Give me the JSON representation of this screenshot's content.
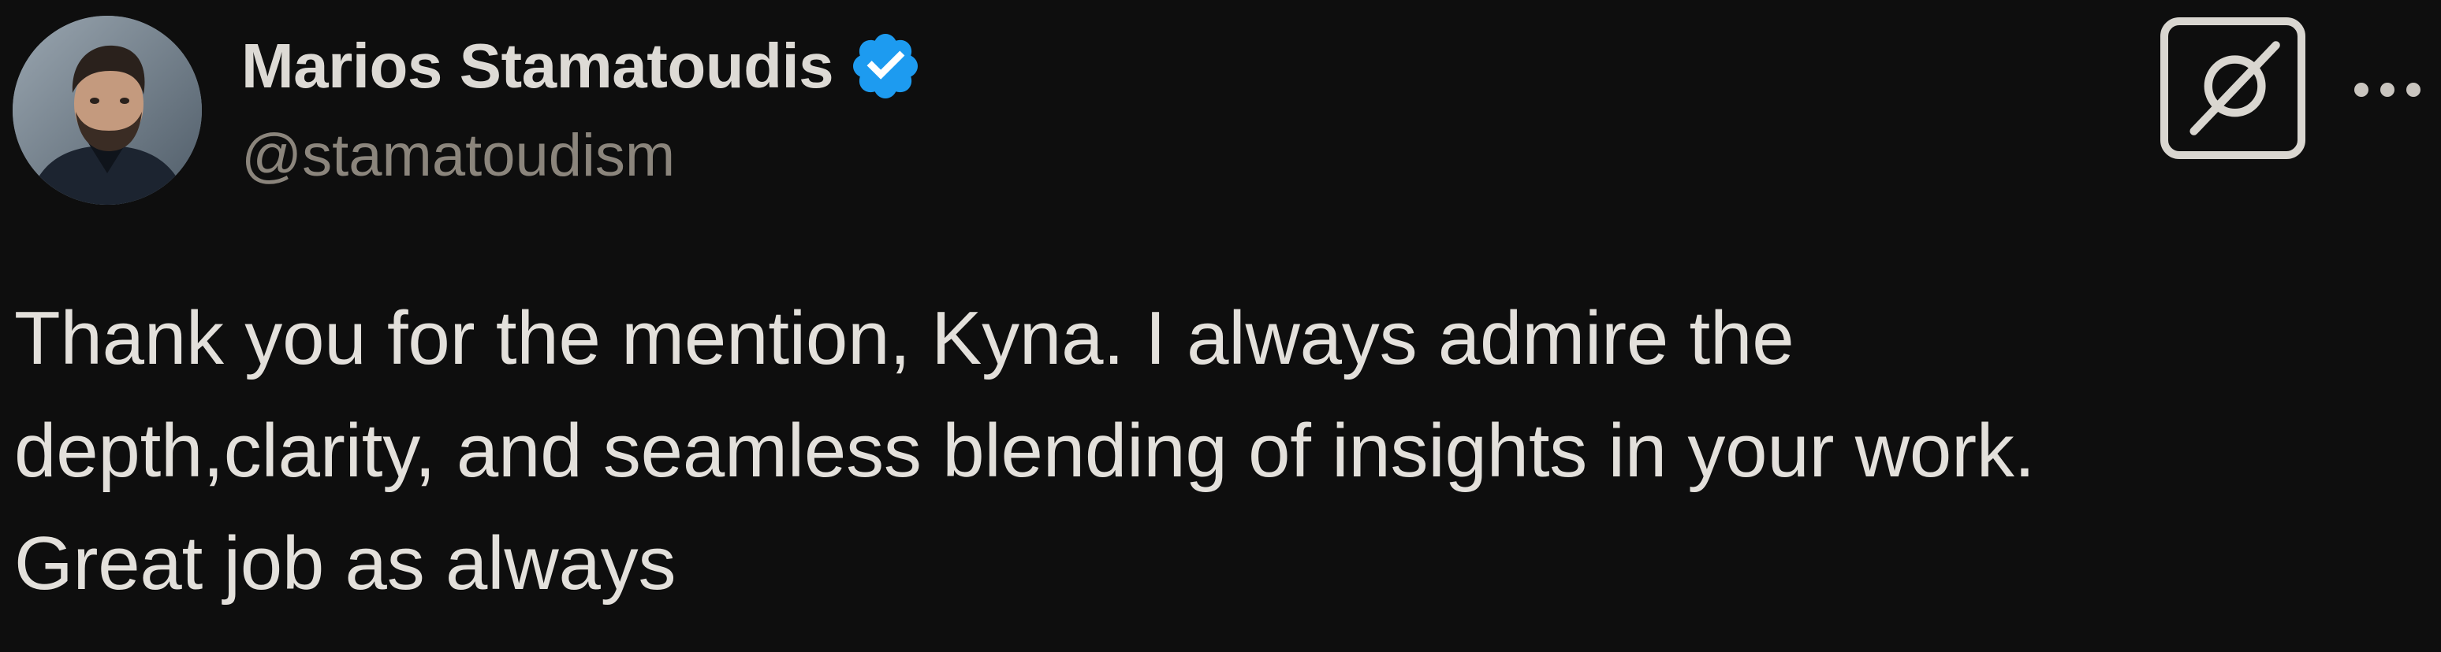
{
  "author": {
    "display_name": "Marios Stamatoudis",
    "handle": "@stamatoudism",
    "verified": true,
    "verified_color": "#1d9bf0"
  },
  "actions": {
    "grok_icon": "grok-icon",
    "more_icon": "more-horizontal-icon"
  },
  "tweet": {
    "text": "Thank you for the mention, Kyna. I always admire the\ndepth,clarity, and seamless blending of insights in your work.\nGreat job as always"
  },
  "colors": {
    "background": "#0e0e0e",
    "text": "#e3e0db",
    "handle": "#8b857c"
  }
}
